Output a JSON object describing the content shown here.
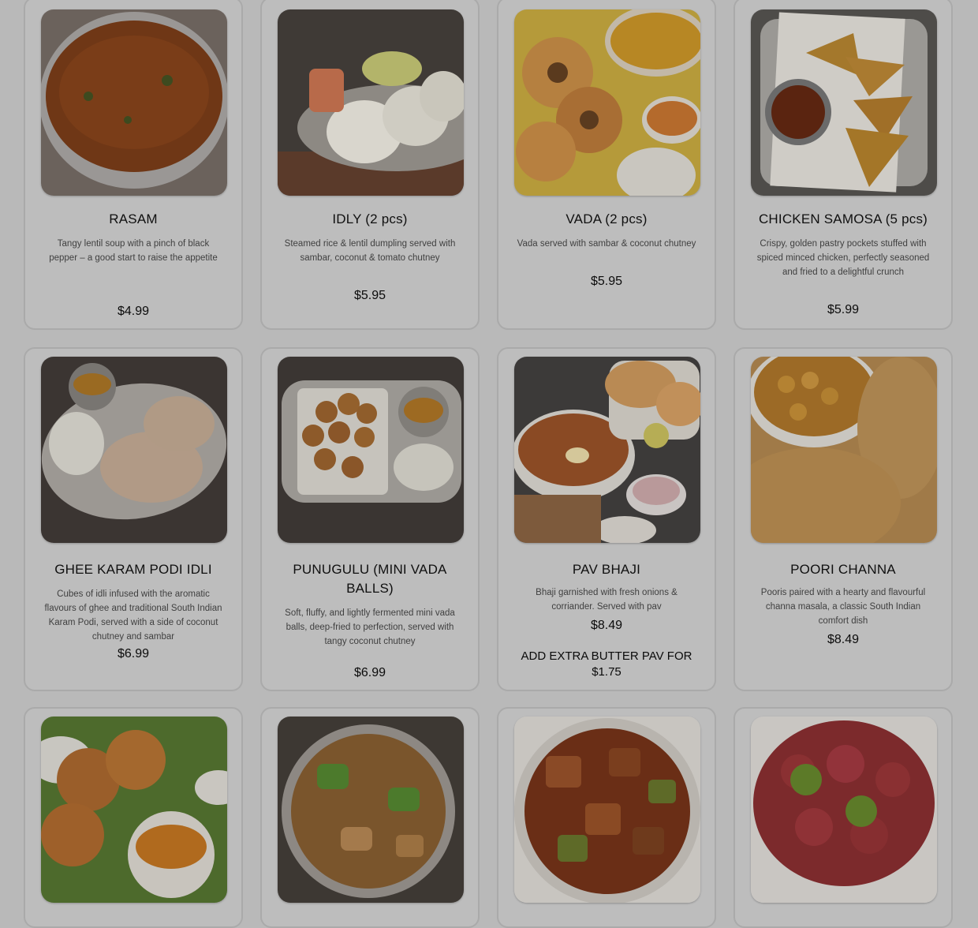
{
  "menu": {
    "items": [
      {
        "name": "RASAM",
        "description": "Tangy lentil soup with a pinch of black pepper – a good start to raise the appetite",
        "price": "$4.99",
        "image": "rasam-photo"
      },
      {
        "name": "IDLY (2 pcs)",
        "description": "Steamed rice & lentil dumpling served with sambar, coconut & tomato chutney",
        "price": "$5.95",
        "image": "idly-photo"
      },
      {
        "name": "VADA (2 pcs)",
        "description": "Vada served with sambar & coconut chutney",
        "price": "$5.95",
        "image": "vada-photo"
      },
      {
        "name": "CHICKEN SAMOSA (5 pcs)",
        "description": "Crispy, golden pastry pockets stuffed with spiced minced chicken, perfectly seasoned and fried to a delightful crunch",
        "price": "$5.99",
        "image": "samosa-photo"
      },
      {
        "name": "GHEE KARAM PODI IDLI",
        "description": "Cubes of idli infused with the aromatic flavours of ghee and traditional South Indian Karam Podi, served with a side of coconut chutney and sambar",
        "price": "$6.99",
        "image": "podi-idli-photo"
      },
      {
        "name": "PUNUGULU (MINI VADA BALLS)",
        "description": "Soft, fluffy, and lightly fermented mini vada balls, deep-fried to perfection, served with tangy coconut chutney",
        "price": "$6.99",
        "image": "punugulu-photo"
      },
      {
        "name": "PAV BHAJI",
        "description": "Bhaji garnished with fresh onions & corriander. Served with pav",
        "price": "$8.49",
        "extra": "ADD EXTRA BUTTER PAV FOR $1.75",
        "image": "pav-bhaji-photo"
      },
      {
        "name": "POORI CHANNA",
        "description": "Pooris paired with a hearty and flavourful channa masala, a classic South Indian comfort dish",
        "price": "$8.49",
        "image": "poori-photo"
      }
    ]
  },
  "colors": {
    "overlay": "#b9b9b9",
    "card": "#bdbdbd",
    "border": "#aaaaaa"
  }
}
